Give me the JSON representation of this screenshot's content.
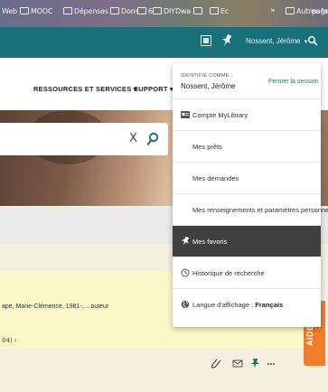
{
  "browser": {
    "bookmarks": [
      "Web",
      "MOOC",
      "Dépenses",
      "Dons",
      "6",
      "DIY",
      "Dwa",
      "",
      "Ec",
      "»",
      "Autres favoris",
      "pages"
    ]
  },
  "topbar": {
    "user_name": "Nossent, Jérôme",
    "icons": [
      "qr-code-icon",
      "pin-icon",
      "search-icon"
    ]
  },
  "nav": {
    "items": [
      "RESSOURCES ET SERVICES ▾",
      "SUPPORT ▾"
    ]
  },
  "search": {
    "clear_label": "X"
  },
  "dropdown": {
    "identified_label": "IDENTIFIÉ COMME :",
    "identified_name": "Nossent, Jérôme",
    "logout_label": "Fermer la session",
    "items": [
      {
        "label": "Compte MyLibrary",
        "icon": "account-card-icon"
      },
      {
        "label": "Mes prêts",
        "icon": ""
      },
      {
        "label": "Mes demandes",
        "icon": ""
      },
      {
        "label": "Mes renseignements et paramètres personnels",
        "icon": ""
      },
      {
        "label": "Mes favoris",
        "icon": "pin-icon"
      },
      {
        "label": "Historique de recherche",
        "icon": "history-icon"
      },
      {
        "label": "Langue d'affichage : ",
        "value": "Français",
        "icon": "globe-icon"
      }
    ],
    "active_index": 4
  },
  "result": {
    "author": "ape, Marie-Clémence, 1981-.... auteur",
    "more": "04)  ›"
  },
  "aide": {
    "label": "AIDE"
  },
  "colors": {
    "teal": "#17707a",
    "aide": "#f07d2a",
    "active_bg": "#3f3f3f",
    "result_bg": "#fbf8c9"
  }
}
